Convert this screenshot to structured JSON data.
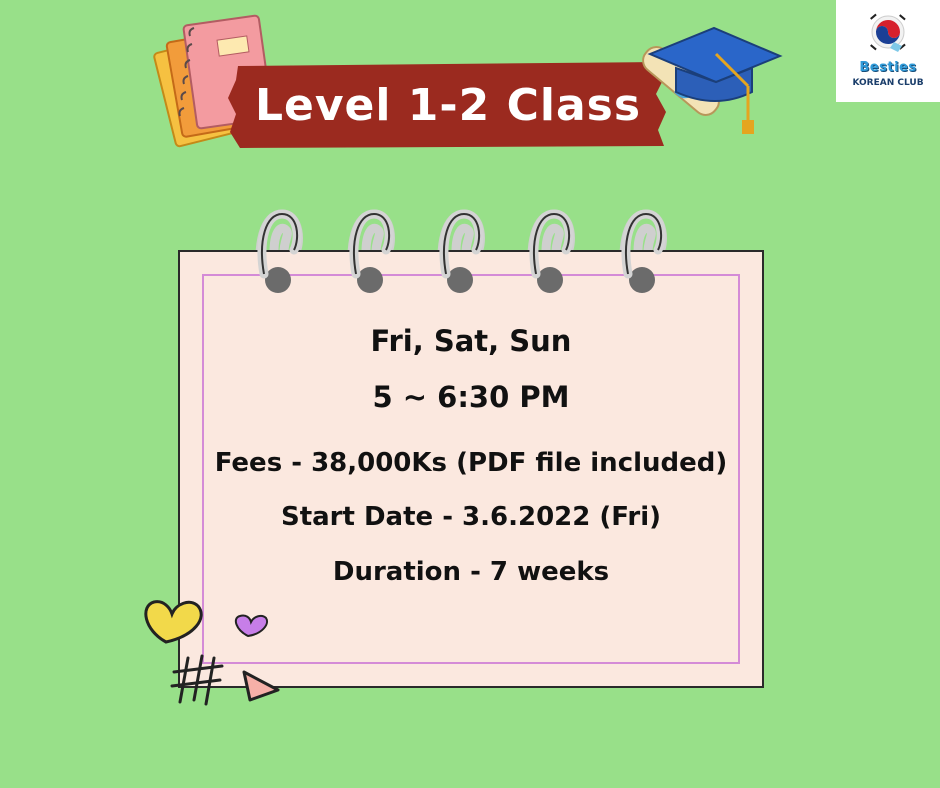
{
  "title": "Level 1-2 Class",
  "logo": {
    "brand": "Besties",
    "sub": "KOREAN CLUB"
  },
  "schedule": {
    "days": "Fri, Sat, Sun",
    "time": "5 ~ 6:30 PM"
  },
  "details": {
    "fees": "Fees - 38,000Ks (PDF file included)",
    "start_date": "Start Date - 3.6.2022 (Fri)",
    "duration": "Duration - 7 weeks"
  },
  "colors": {
    "background": "#98e089",
    "banner": "#9b2a1f",
    "card": "#fbe8df",
    "card_border_inner": "#d48bd7"
  },
  "decorations": [
    "notebooks-icon",
    "graduation-cap-icon",
    "spiral-rings-icon",
    "heart-icon",
    "hashtag-doodle-icon",
    "triangle-icon"
  ]
}
